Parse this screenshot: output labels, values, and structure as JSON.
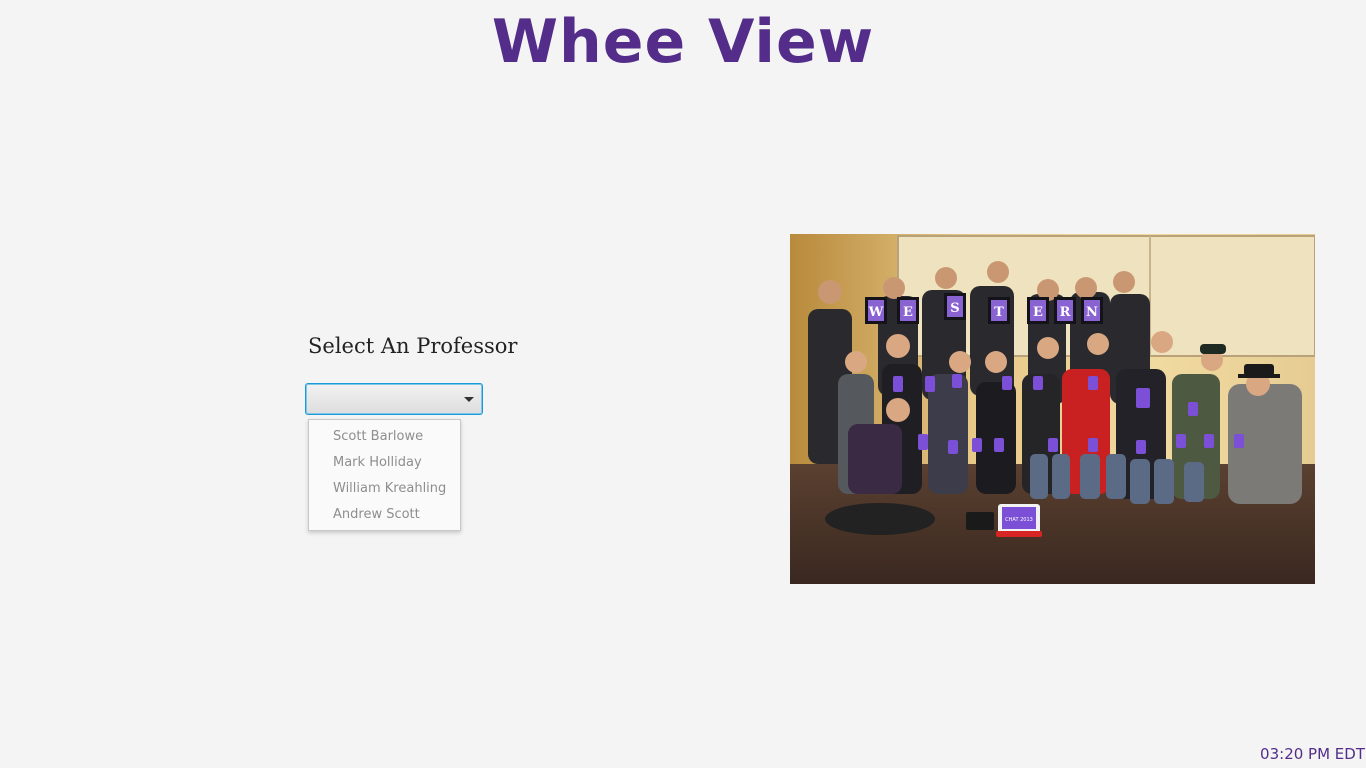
{
  "app": {
    "title": "Whee View"
  },
  "professor_select": {
    "label": "Select An Professor",
    "selected_value": "",
    "options": [
      "Scott Barlowe",
      "Mark Holliday",
      "William Kreahling",
      "Andrew Scott"
    ]
  },
  "photo": {
    "letters_top": [
      "W",
      "E",
      "S",
      "T",
      "E",
      "R",
      "N"
    ],
    "tablet_label": "CHAT 2013"
  },
  "status": {
    "time": "03:20 PM EDT"
  },
  "colors": {
    "brand_purple": "#542d8a",
    "focus_blue": "#1a9bd7",
    "background": "#f4f4f4"
  }
}
